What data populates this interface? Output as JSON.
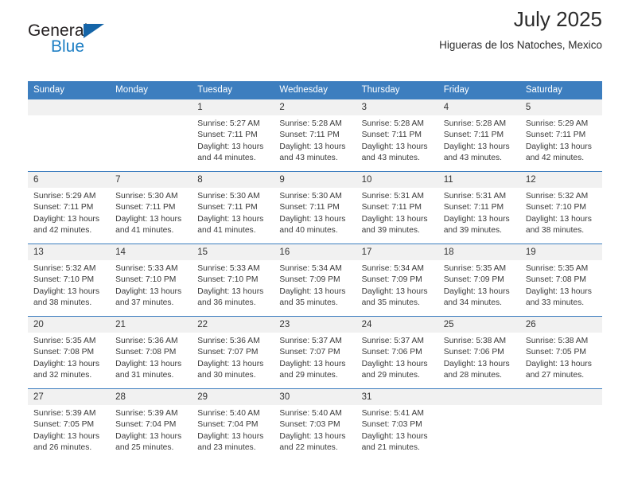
{
  "brand": {
    "name_part1": "General",
    "name_part2": "Blue",
    "triangle_color": "#1565a8",
    "blue_text_color": "#1e7fc4"
  },
  "header": {
    "title": "July 2025",
    "subtitle": "Higueras de los Natoches, Mexico"
  },
  "theme": {
    "header_row_bg": "#3d7ebf",
    "daynum_bg": "#f1f1f1",
    "row_divider": "#3d7ebf",
    "text": "#3a3a3a"
  },
  "weekday_headers": [
    "Sunday",
    "Monday",
    "Tuesday",
    "Wednesday",
    "Thursday",
    "Friday",
    "Saturday"
  ],
  "labels": {
    "sunrise_prefix": "Sunrise:",
    "sunset_prefix": "Sunset:",
    "daylight_prefix": "Daylight:"
  },
  "weeks": [
    [
      {
        "day": ""
      },
      {
        "day": ""
      },
      {
        "day": "1",
        "sunrise": "Sunrise: 5:27 AM",
        "sunset": "Sunset: 7:11 PM",
        "daylight_line1": "Daylight: 13 hours",
        "daylight_line2": "and 44 minutes."
      },
      {
        "day": "2",
        "sunrise": "Sunrise: 5:28 AM",
        "sunset": "Sunset: 7:11 PM",
        "daylight_line1": "Daylight: 13 hours",
        "daylight_line2": "and 43 minutes."
      },
      {
        "day": "3",
        "sunrise": "Sunrise: 5:28 AM",
        "sunset": "Sunset: 7:11 PM",
        "daylight_line1": "Daylight: 13 hours",
        "daylight_line2": "and 43 minutes."
      },
      {
        "day": "4",
        "sunrise": "Sunrise: 5:28 AM",
        "sunset": "Sunset: 7:11 PM",
        "daylight_line1": "Daylight: 13 hours",
        "daylight_line2": "and 43 minutes."
      },
      {
        "day": "5",
        "sunrise": "Sunrise: 5:29 AM",
        "sunset": "Sunset: 7:11 PM",
        "daylight_line1": "Daylight: 13 hours",
        "daylight_line2": "and 42 minutes."
      }
    ],
    [
      {
        "day": "6",
        "sunrise": "Sunrise: 5:29 AM",
        "sunset": "Sunset: 7:11 PM",
        "daylight_line1": "Daylight: 13 hours",
        "daylight_line2": "and 42 minutes."
      },
      {
        "day": "7",
        "sunrise": "Sunrise: 5:30 AM",
        "sunset": "Sunset: 7:11 PM",
        "daylight_line1": "Daylight: 13 hours",
        "daylight_line2": "and 41 minutes."
      },
      {
        "day": "8",
        "sunrise": "Sunrise: 5:30 AM",
        "sunset": "Sunset: 7:11 PM",
        "daylight_line1": "Daylight: 13 hours",
        "daylight_line2": "and 41 minutes."
      },
      {
        "day": "9",
        "sunrise": "Sunrise: 5:30 AM",
        "sunset": "Sunset: 7:11 PM",
        "daylight_line1": "Daylight: 13 hours",
        "daylight_line2": "and 40 minutes."
      },
      {
        "day": "10",
        "sunrise": "Sunrise: 5:31 AM",
        "sunset": "Sunset: 7:11 PM",
        "daylight_line1": "Daylight: 13 hours",
        "daylight_line2": "and 39 minutes."
      },
      {
        "day": "11",
        "sunrise": "Sunrise: 5:31 AM",
        "sunset": "Sunset: 7:11 PM",
        "daylight_line1": "Daylight: 13 hours",
        "daylight_line2": "and 39 minutes."
      },
      {
        "day": "12",
        "sunrise": "Sunrise: 5:32 AM",
        "sunset": "Sunset: 7:10 PM",
        "daylight_line1": "Daylight: 13 hours",
        "daylight_line2": "and 38 minutes."
      }
    ],
    [
      {
        "day": "13",
        "sunrise": "Sunrise: 5:32 AM",
        "sunset": "Sunset: 7:10 PM",
        "daylight_line1": "Daylight: 13 hours",
        "daylight_line2": "and 38 minutes."
      },
      {
        "day": "14",
        "sunrise": "Sunrise: 5:33 AM",
        "sunset": "Sunset: 7:10 PM",
        "daylight_line1": "Daylight: 13 hours",
        "daylight_line2": "and 37 minutes."
      },
      {
        "day": "15",
        "sunrise": "Sunrise: 5:33 AM",
        "sunset": "Sunset: 7:10 PM",
        "daylight_line1": "Daylight: 13 hours",
        "daylight_line2": "and 36 minutes."
      },
      {
        "day": "16",
        "sunrise": "Sunrise: 5:34 AM",
        "sunset": "Sunset: 7:09 PM",
        "daylight_line1": "Daylight: 13 hours",
        "daylight_line2": "and 35 minutes."
      },
      {
        "day": "17",
        "sunrise": "Sunrise: 5:34 AM",
        "sunset": "Sunset: 7:09 PM",
        "daylight_line1": "Daylight: 13 hours",
        "daylight_line2": "and 35 minutes."
      },
      {
        "day": "18",
        "sunrise": "Sunrise: 5:35 AM",
        "sunset": "Sunset: 7:09 PM",
        "daylight_line1": "Daylight: 13 hours",
        "daylight_line2": "and 34 minutes."
      },
      {
        "day": "19",
        "sunrise": "Sunrise: 5:35 AM",
        "sunset": "Sunset: 7:08 PM",
        "daylight_line1": "Daylight: 13 hours",
        "daylight_line2": "and 33 minutes."
      }
    ],
    [
      {
        "day": "20",
        "sunrise": "Sunrise: 5:35 AM",
        "sunset": "Sunset: 7:08 PM",
        "daylight_line1": "Daylight: 13 hours",
        "daylight_line2": "and 32 minutes."
      },
      {
        "day": "21",
        "sunrise": "Sunrise: 5:36 AM",
        "sunset": "Sunset: 7:08 PM",
        "daylight_line1": "Daylight: 13 hours",
        "daylight_line2": "and 31 minutes."
      },
      {
        "day": "22",
        "sunrise": "Sunrise: 5:36 AM",
        "sunset": "Sunset: 7:07 PM",
        "daylight_line1": "Daylight: 13 hours",
        "daylight_line2": "and 30 minutes."
      },
      {
        "day": "23",
        "sunrise": "Sunrise: 5:37 AM",
        "sunset": "Sunset: 7:07 PM",
        "daylight_line1": "Daylight: 13 hours",
        "daylight_line2": "and 29 minutes."
      },
      {
        "day": "24",
        "sunrise": "Sunrise: 5:37 AM",
        "sunset": "Sunset: 7:06 PM",
        "daylight_line1": "Daylight: 13 hours",
        "daylight_line2": "and 29 minutes."
      },
      {
        "day": "25",
        "sunrise": "Sunrise: 5:38 AM",
        "sunset": "Sunset: 7:06 PM",
        "daylight_line1": "Daylight: 13 hours",
        "daylight_line2": "and 28 minutes."
      },
      {
        "day": "26",
        "sunrise": "Sunrise: 5:38 AM",
        "sunset": "Sunset: 7:05 PM",
        "daylight_line1": "Daylight: 13 hours",
        "daylight_line2": "and 27 minutes."
      }
    ],
    [
      {
        "day": "27",
        "sunrise": "Sunrise: 5:39 AM",
        "sunset": "Sunset: 7:05 PM",
        "daylight_line1": "Daylight: 13 hours",
        "daylight_line2": "and 26 minutes."
      },
      {
        "day": "28",
        "sunrise": "Sunrise: 5:39 AM",
        "sunset": "Sunset: 7:04 PM",
        "daylight_line1": "Daylight: 13 hours",
        "daylight_line2": "and 25 minutes."
      },
      {
        "day": "29",
        "sunrise": "Sunrise: 5:40 AM",
        "sunset": "Sunset: 7:04 PM",
        "daylight_line1": "Daylight: 13 hours",
        "daylight_line2": "and 23 minutes."
      },
      {
        "day": "30",
        "sunrise": "Sunrise: 5:40 AM",
        "sunset": "Sunset: 7:03 PM",
        "daylight_line1": "Daylight: 13 hours",
        "daylight_line2": "and 22 minutes."
      },
      {
        "day": "31",
        "sunrise": "Sunrise: 5:41 AM",
        "sunset": "Sunset: 7:03 PM",
        "daylight_line1": "Daylight: 13 hours",
        "daylight_line2": "and 21 minutes."
      },
      {
        "day": ""
      },
      {
        "day": ""
      }
    ]
  ]
}
